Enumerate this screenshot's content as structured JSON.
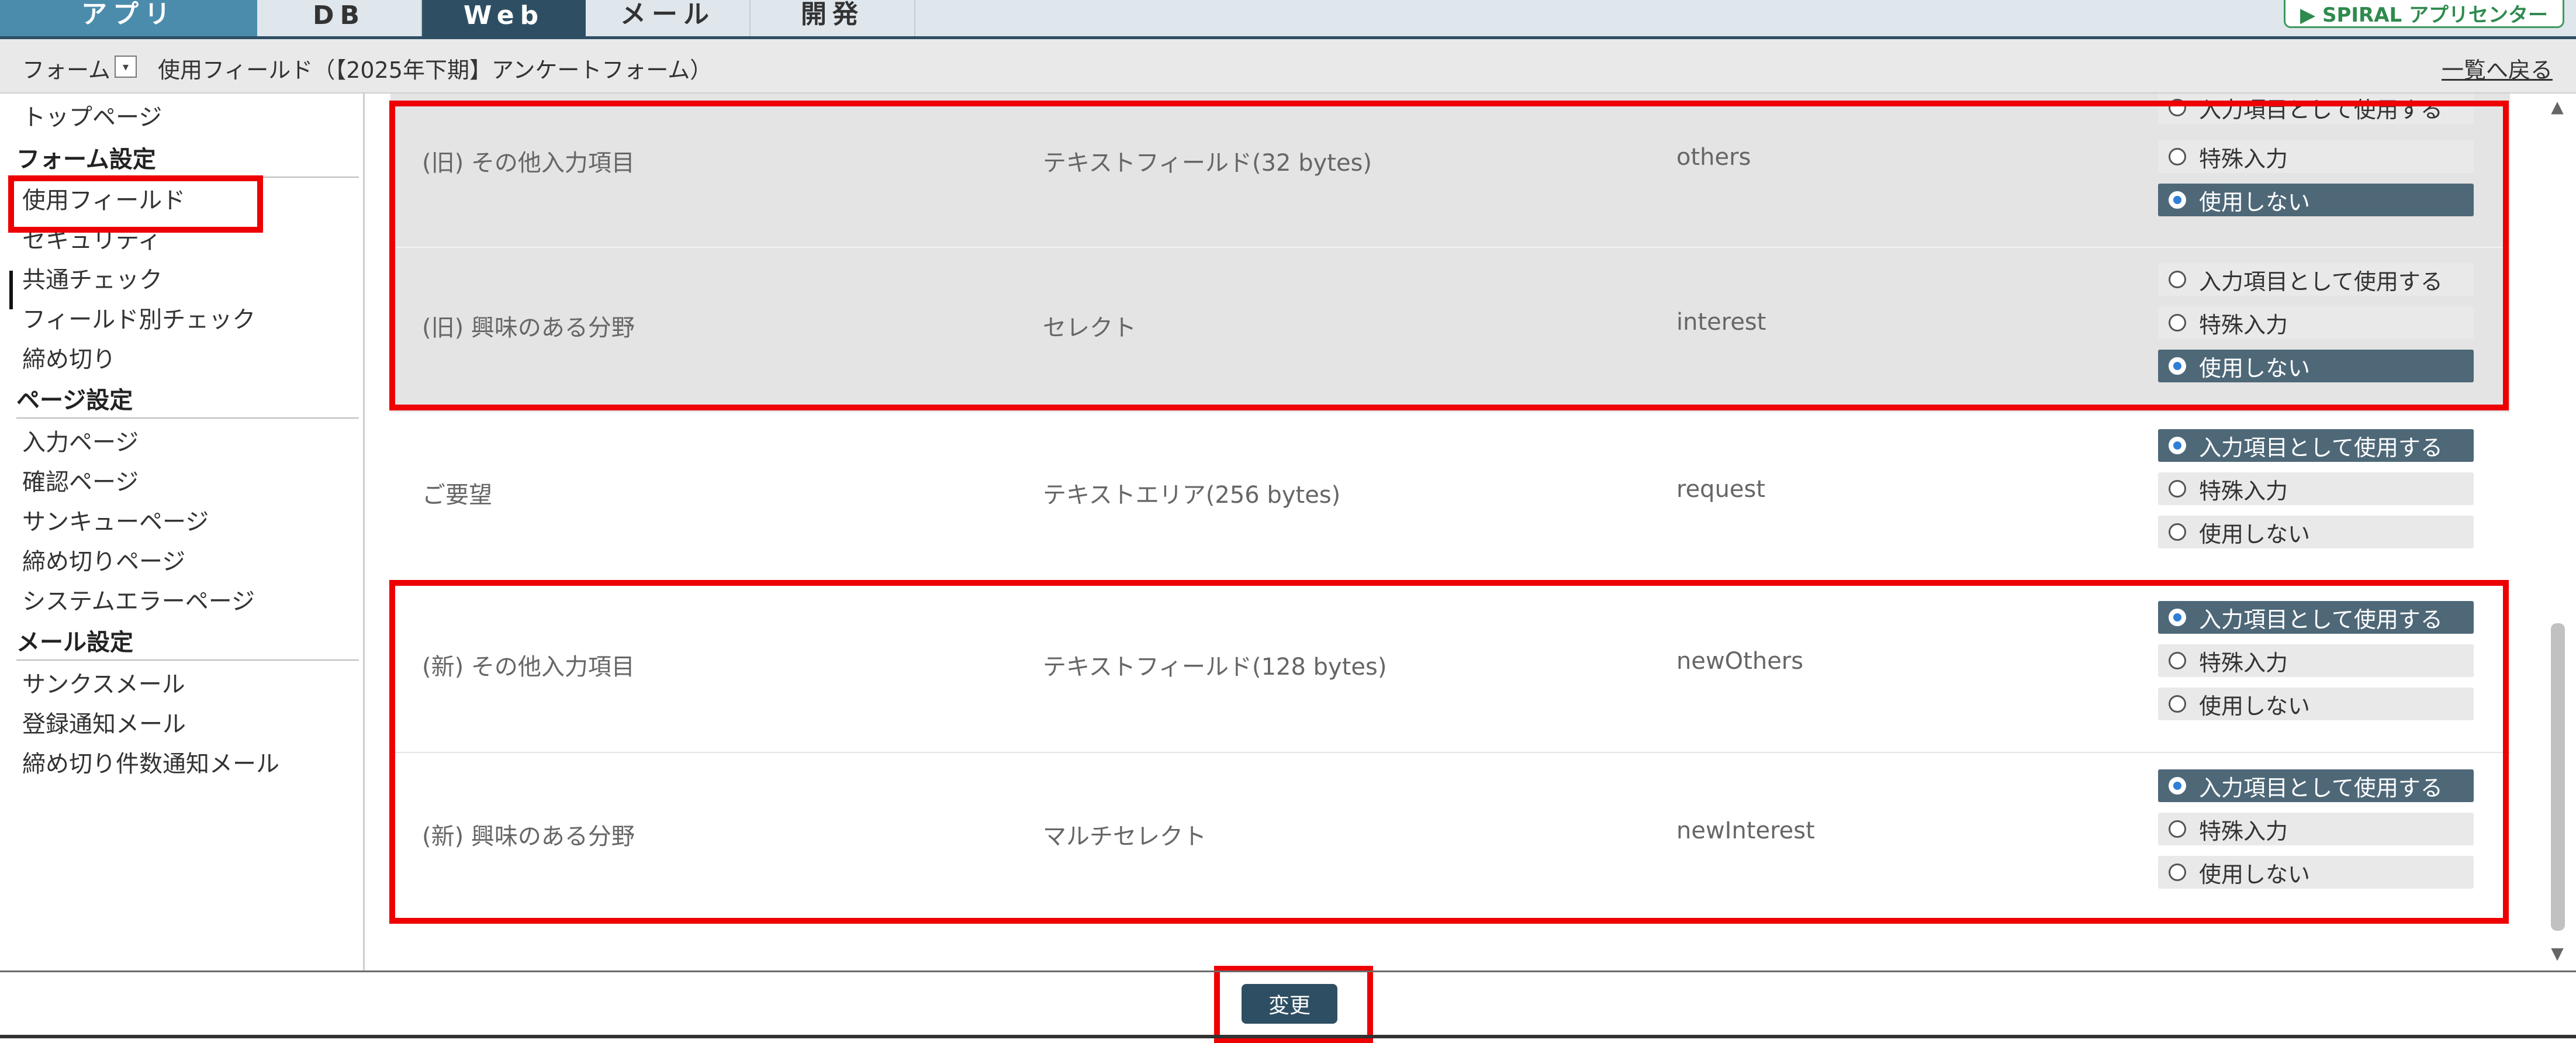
{
  "nav": {
    "tabs": [
      "アプリ",
      "DB",
      "Web",
      "メール",
      "開発"
    ],
    "active_tab": "Web",
    "logo_text": "▶ SPIRAL アプリセンター"
  },
  "breadcrumb": {
    "root": "フォーム",
    "dropdown_icon": "▾",
    "title": "使用フィールド（【2025年下期】アンケートフォーム）",
    "back_link": "一覧へ戻る"
  },
  "sidebar": {
    "top_item": "トップページ",
    "sections": [
      {
        "heading": "フォーム設定",
        "items": [
          "使用フィールド",
          "セキュリティ",
          "共通チェック",
          "フィールド別チェック",
          "締め切り"
        ]
      },
      {
        "heading": "ページ設定",
        "items": [
          "入力ページ",
          "確認ページ",
          "サンキューページ",
          "締め切りページ",
          "システムエラーページ"
        ]
      },
      {
        "heading": "メール設定",
        "items": [
          "サンクスメール",
          "登録通知メール",
          "締め切り件数通知メール"
        ]
      }
    ],
    "selected": "使用フィールド"
  },
  "options": [
    "入力項目として使用する",
    "特殊入力",
    "使用しない"
  ],
  "fields": [
    {
      "label": "(旧) その他入力項目",
      "type": "テキストフィールド(32 bytes)",
      "name": "others",
      "selected": 2
    },
    {
      "label": "(旧) 興味のある分野",
      "type": "セレクト",
      "name": "interest",
      "selected": 2
    },
    {
      "label": "ご要望",
      "type": "テキストエリア(256 bytes)",
      "name": "request",
      "selected": 0
    },
    {
      "label": "(新) その他入力項目",
      "type": "テキストフィールド(128 bytes)",
      "name": "newOthers",
      "selected": 0
    },
    {
      "label": "(新) 興味のある分野",
      "type": "マルチセレクト",
      "name": "newInterest",
      "selected": 0
    }
  ],
  "actions": {
    "submit_label": "変更"
  },
  "colors": {
    "nav_active": "#2e4f63",
    "nav_app": "#4b8cad",
    "highlight": "#ee0000",
    "selected_option": "#4e6878"
  }
}
